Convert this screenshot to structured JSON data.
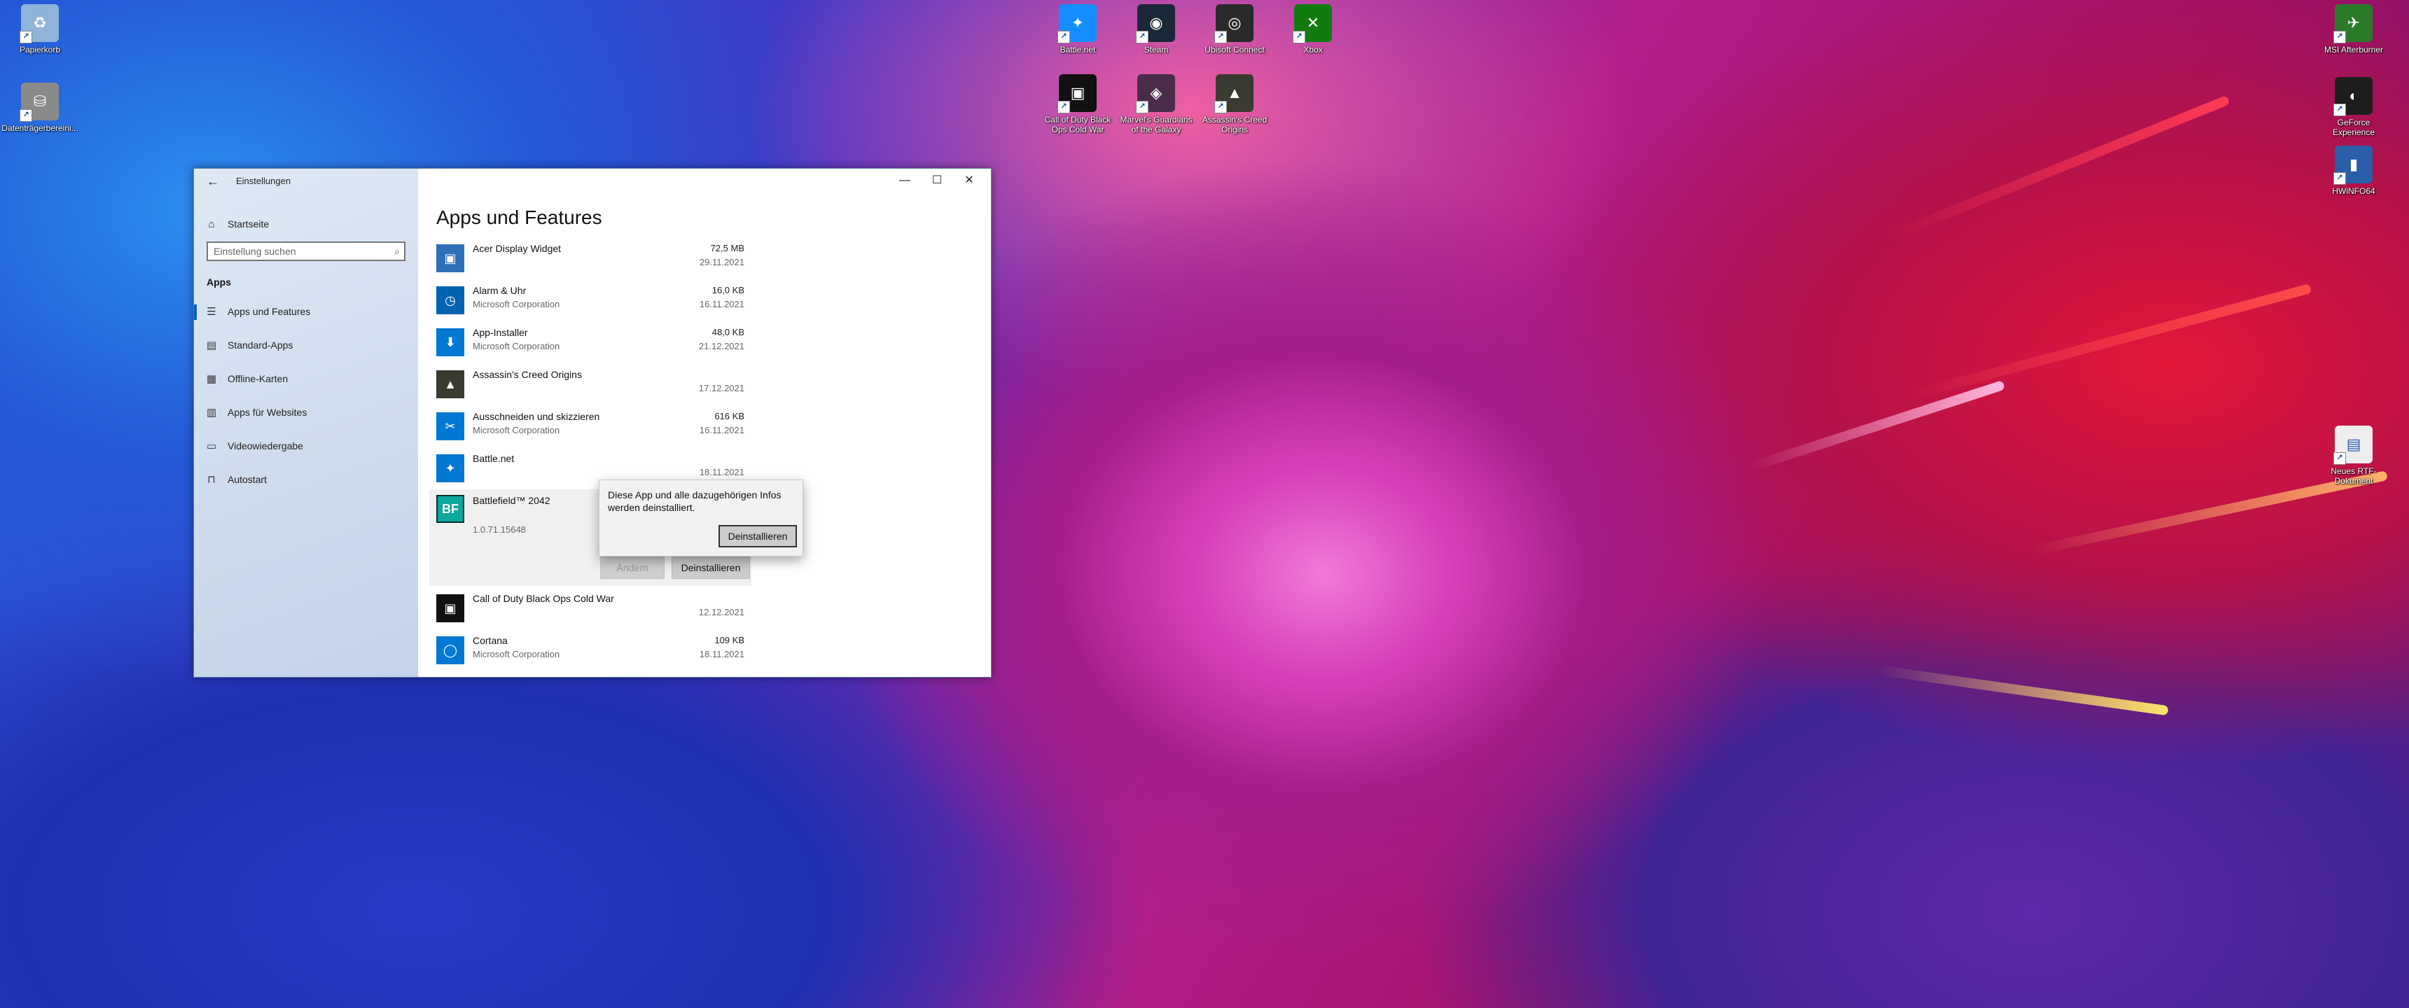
{
  "desktop": {
    "left_icons": [
      {
        "label": "Papierkorb",
        "icon": "recycle-bin-icon"
      },
      {
        "label": "Datenträgerbereini...",
        "icon": "disk-cleanup-icon"
      }
    ],
    "top_icons": [
      {
        "label": "Battle.net",
        "icon": "battlenet-icon",
        "color": "#148eff"
      },
      {
        "label": "Steam",
        "icon": "steam-icon",
        "color": "#1b2838"
      },
      {
        "label": "Ubisoft Connect",
        "icon": "ubisoft-icon",
        "color": "#2a2a2a"
      },
      {
        "label": "Xbox",
        "icon": "xbox-icon",
        "color": "#107c10"
      },
      {
        "label": "Call of Duty Black Ops Cold War",
        "icon": "cod-icon",
        "color": "#111111"
      },
      {
        "label": "Marvel's Guardians of the Galaxy",
        "icon": "guardians-icon",
        "color": "#4a2c4a"
      },
      {
        "label": "Assassin's Creed Origins",
        "icon": "assassins-creed-icon",
        "color": "#3b3a30"
      }
    ],
    "right_icons": [
      {
        "label": "MSI Afterburner",
        "icon": "msi-afterburner-icon"
      },
      {
        "label": "GeForce Experience",
        "icon": "geforce-icon"
      },
      {
        "label": "HWiNFO64",
        "icon": "hwinfo-icon"
      },
      {
        "label": "Neues RTF-Dokument",
        "icon": "rtf-document-icon"
      }
    ]
  },
  "window": {
    "title": "Einstellungen",
    "back_glyph": "←",
    "controls": {
      "minimize": "—",
      "maximize": "☐",
      "close": "✕"
    }
  },
  "nav": {
    "home_label": "Startseite",
    "search_placeholder": "Einstellung suchen",
    "section": "Apps",
    "items": [
      {
        "label": "Apps und Features",
        "glyph": "☰",
        "active": true
      },
      {
        "label": "Standard-Apps",
        "glyph": "▤"
      },
      {
        "label": "Offline-Karten",
        "glyph": "▦"
      },
      {
        "label": "Apps für Websites",
        "glyph": "▥"
      },
      {
        "label": "Videowiedergabe",
        "glyph": "▭"
      },
      {
        "label": "Autostart",
        "glyph": "⊓"
      }
    ]
  },
  "content": {
    "title": "Apps und Features",
    "apps": [
      {
        "name": "Acer Display Widget",
        "publisher": "",
        "size": "72,5 MB",
        "date": "29.11.2021",
        "icon": "acer-widget-icon",
        "color": "#2f6fb8"
      },
      {
        "name": "Alarm & Uhr",
        "publisher": "Microsoft Corporation",
        "size": "16,0 KB",
        "date": "16.11.2021",
        "icon": "alarm-clock-icon",
        "color": "#0063b1"
      },
      {
        "name": "App-Installer",
        "publisher": "Microsoft Corporation",
        "size": "48,0 KB",
        "date": "21.12.2021",
        "icon": "app-installer-icon",
        "color": "#0078d4"
      },
      {
        "name": "Assassin's Creed Origins",
        "publisher": "",
        "size": "",
        "date": "17.12.2021",
        "icon": "assassins-creed-icon",
        "color": "#3b3a30"
      },
      {
        "name": "Ausschneiden und skizzieren",
        "publisher": "Microsoft Corporation",
        "size": "616 KB",
        "date": "16.11.2021",
        "icon": "snip-sketch-icon",
        "color": "#0078d4"
      },
      {
        "name": "Battle.net",
        "publisher": "",
        "size": "",
        "date": "18.11.2021",
        "icon": "battlenet-icon",
        "color": "#0078d4"
      },
      {
        "name": "Call of Duty Black Ops Cold War",
        "publisher": "",
        "size": "",
        "date": "12.12.2021",
        "icon": "cod-icon",
        "color": "#111111"
      },
      {
        "name": "Cortana",
        "publisher": "Microsoft Corporation",
        "size": "109 KB",
        "date": "18.11.2021",
        "icon": "cortana-icon",
        "color": "#0078d4"
      }
    ],
    "expanded": {
      "name": "Battlefield™ 2042",
      "version": "1.0.71.15648",
      "icon_text": "BF",
      "modify_label": "Ändern",
      "uninstall_label": "Deinstallieren"
    },
    "flyout": {
      "message": "Diese App und alle dazugehörigen Infos werden deinstalliert.",
      "button": "Deinstallieren"
    }
  }
}
